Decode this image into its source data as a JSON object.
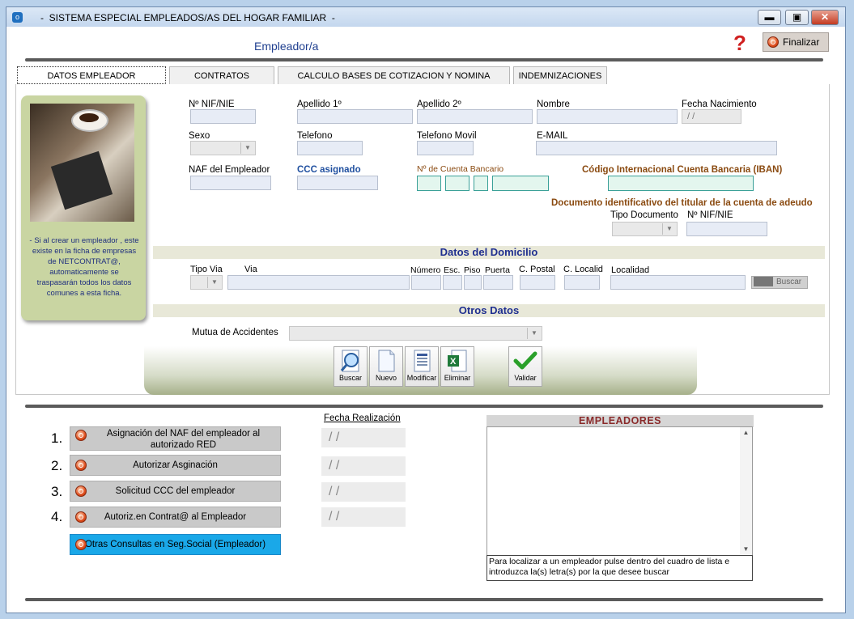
{
  "window": {
    "title": "-  SISTEMA ESPECIAL EMPLEADOS/AS DEL HOGAR FAMILIAR  -",
    "app_icon": "app-icon",
    "minimize_label": "▬",
    "maximize_label": "▣",
    "close_label": "✕"
  },
  "header": {
    "title": "Empleador/a",
    "help_glyph": "?",
    "finalizar_label": "Finalizar"
  },
  "tabs": [
    {
      "label": "DATOS EMPLEADOR",
      "active": true
    },
    {
      "label": "CONTRATOS",
      "active": false
    },
    {
      "label": "CALCULO BASES DE COTIZACION  Y NOMINA",
      "active": false
    },
    {
      "label": "INDEMNIZACIONES",
      "active": false
    }
  ],
  "sidebar": {
    "note": "- Si al crear un empleador , este existe en la ficha de empresas de NETCONTRAT@, automaticamente se traspasarán todos los datos comunes a esta ficha."
  },
  "form": {
    "nif_label": "Nº  NIF/NIE",
    "apellido1_label": "Apellido 1º",
    "apellido2_label": "Apellido 2º",
    "nombre_label": "Nombre",
    "fecha_nac_label": "Fecha Nacimiento",
    "fecha_nac_value": "/ /",
    "sexo_label": "Sexo",
    "telefono_label": "Telefono",
    "movil_label": "Telefono Movil",
    "email_label": "E-MAIL",
    "naf_label": "NAF del Empleador",
    "ccc_label": "CCC asignado",
    "cuenta_label": "Nº de Cuenta Bancario",
    "iban_label": "Código Internacional Cuenta Bancaria (IBAN)",
    "doc_titular_label": "Documento identificativo del titular de la cuenta de adeudo",
    "tipo_doc_label": "Tipo Documento",
    "titular_nif_label": "Nº  NIF/NIE"
  },
  "domicilio": {
    "section_title": "Datos del Domicilio",
    "tipo_via_label": "Tipo Via",
    "via_label": "Via",
    "numero_label": "Número",
    "esc_label": "Esc.",
    "piso_label": "Piso",
    "puerta_label": "Puerta",
    "cpostal_label": "C. Postal",
    "clocalid_label": "C. Localid",
    "localidad_label": "Localidad",
    "buscar_label": "Buscar"
  },
  "otros": {
    "section_title": "Otros Datos",
    "mutua_label": "Mutua de Accidentes"
  },
  "toolbar": {
    "buscar": "Buscar",
    "nuevo": "Nuevo",
    "modificar": "Modificar",
    "eliminar": "Eliminar",
    "validar": "Validar"
  },
  "steps": {
    "fecha_header": "Fecha Realización",
    "items": [
      {
        "num": "1.",
        "label": "Asignación del NAF del empleador al autorizado RED",
        "date": "/ /"
      },
      {
        "num": "2.",
        "label": "Autorizar Asginación",
        "date": "/ /"
      },
      {
        "num": "3.",
        "label": "Solicitud CCC del empleador",
        "date": "/ /"
      },
      {
        "num": "4.",
        "label": "Autoriz.en Contrat@ al Empleador",
        "date": "/ /"
      }
    ],
    "otras_consultas": "Otras Consultas en Seg.Social (Empleador)"
  },
  "empleadores": {
    "title": "EMPLEADORES",
    "hint": "Para localizar a un empleador pulse dentro del cuadro de lista e introduzca la(s) letra(s) por la que desee buscar"
  },
  "colors": {
    "accent_blue": "#1f3f8f",
    "iban_brown": "#8a4a10",
    "otras_consultas_bg": "#1aa8e8",
    "sidebar_green": "#c9d5a2"
  }
}
